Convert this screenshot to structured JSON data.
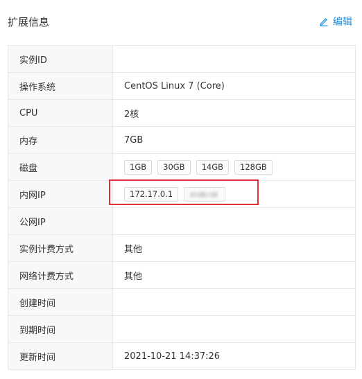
{
  "header": {
    "title": "扩展信息",
    "edit_label": "编辑",
    "edit_icon": "pencil-icon",
    "accent_color": "#1d8de0"
  },
  "rows": {
    "instance_id": {
      "label": "实例ID",
      "value": ""
    },
    "os": {
      "label": "操作系统",
      "value": "CentOS Linux 7 (Core)"
    },
    "cpu": {
      "label": "CPU",
      "value": "2核"
    },
    "memory": {
      "label": "内存",
      "value": "7GB"
    },
    "disk": {
      "label": "磁盘",
      "tags": [
        "1GB",
        "30GB",
        "14GB",
        "128GB"
      ]
    },
    "private_ip": {
      "label": "内网IP",
      "tags": [
        "172.17.0.1"
      ],
      "redacted_tag": true
    },
    "public_ip": {
      "label": "公网IP",
      "value": ""
    },
    "instance_billing": {
      "label": "实例计费方式",
      "value": "其他"
    },
    "network_billing": {
      "label": "网络计费方式",
      "value": "其他"
    },
    "created_time": {
      "label": "创建时间",
      "value": ""
    },
    "expire_time": {
      "label": "到期时间",
      "value": ""
    },
    "updated_time": {
      "label": "更新时间",
      "value": "2021-10-21 14:37:26"
    }
  },
  "highlight_color": "#e0303a"
}
